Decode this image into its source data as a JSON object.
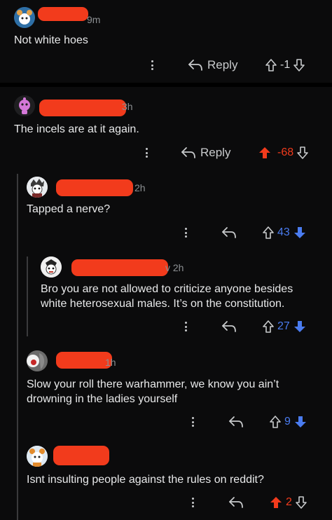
{
  "colors": {
    "background": "#0b0b0c",
    "upvoted": "#f23b1c",
    "downvoted": "#4a7cf0",
    "text": "#e8e9ea",
    "muted": "#8c8f92"
  },
  "comments": [
    {
      "age": "9m",
      "body": "Not white hoes",
      "reply_label": "Reply",
      "score": "-1",
      "vote": "none"
    },
    {
      "age": "3h",
      "body": "The incels are at it again.",
      "reply_label": "Reply",
      "score": "-68",
      "vote": "up"
    },
    {
      "age": "2h",
      "body": "Tapped a nerve?",
      "score": "43",
      "vote": "down"
    },
    {
      "age": "v 2h",
      "body_line1": "Bro you are not allowed to criticize anyone besides",
      "body_line2": "white heterosexual males. It’s on the constitution.",
      "score": "27",
      "vote": "down"
    },
    {
      "age": "1h",
      "body_line1": "Slow your roll there warhammer, we know you ain’t",
      "body_line2": "drowning in the ladies yourself",
      "score": "9",
      "vote": "down"
    },
    {
      "age": "",
      "body": "Isnt insulting people against the rules on reddit?",
      "score": "2",
      "vote": "up"
    }
  ],
  "icons": {
    "more": "more-vertical-icon",
    "reply": "reply-arrow-icon",
    "upvote": "upvote-arrow-icon",
    "downvote": "downvote-arrow-icon"
  }
}
